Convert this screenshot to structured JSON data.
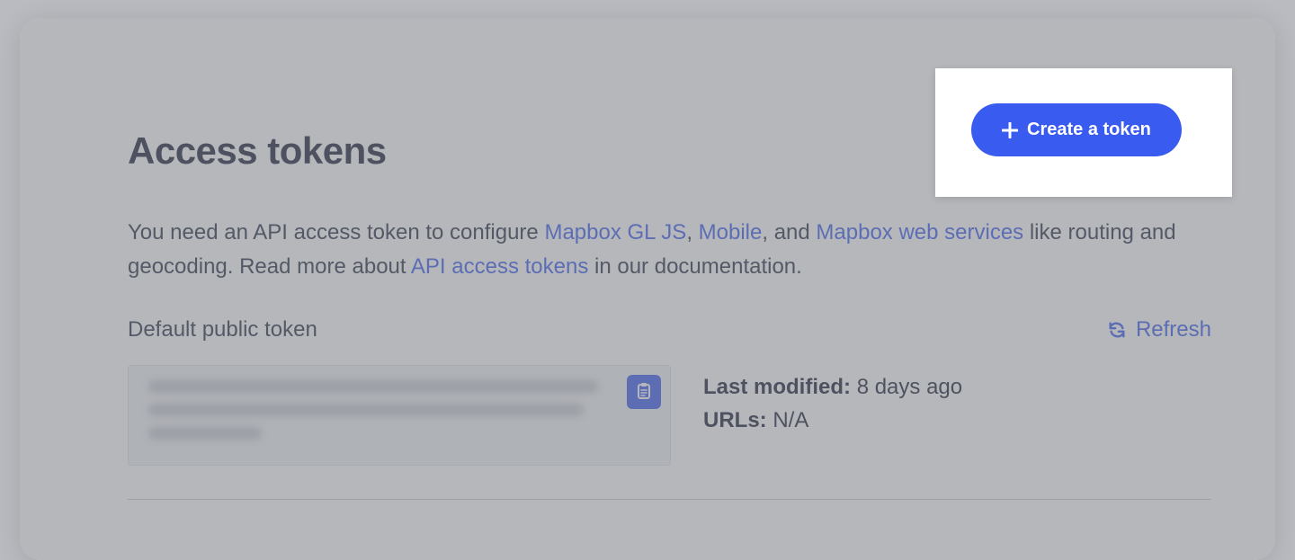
{
  "page": {
    "title": "Access tokens"
  },
  "actions": {
    "create_token_label": "Create a token"
  },
  "description": {
    "part1": "You need an API access token to configure ",
    "link1": "Mapbox GL JS",
    "sep1": ", ",
    "link2": "Mobile",
    "sep2": ", and ",
    "link3": "Mapbox web services",
    "part2": " like routing and geocoding. Read more about ",
    "link4": "API access tokens",
    "part3": " in our documentation."
  },
  "token_section": {
    "heading": "Default public token",
    "refresh_label": "Refresh",
    "last_modified_label": "Last modified:",
    "last_modified_value": "8 days ago",
    "urls_label": "URLs:",
    "urls_value": "N/A"
  }
}
